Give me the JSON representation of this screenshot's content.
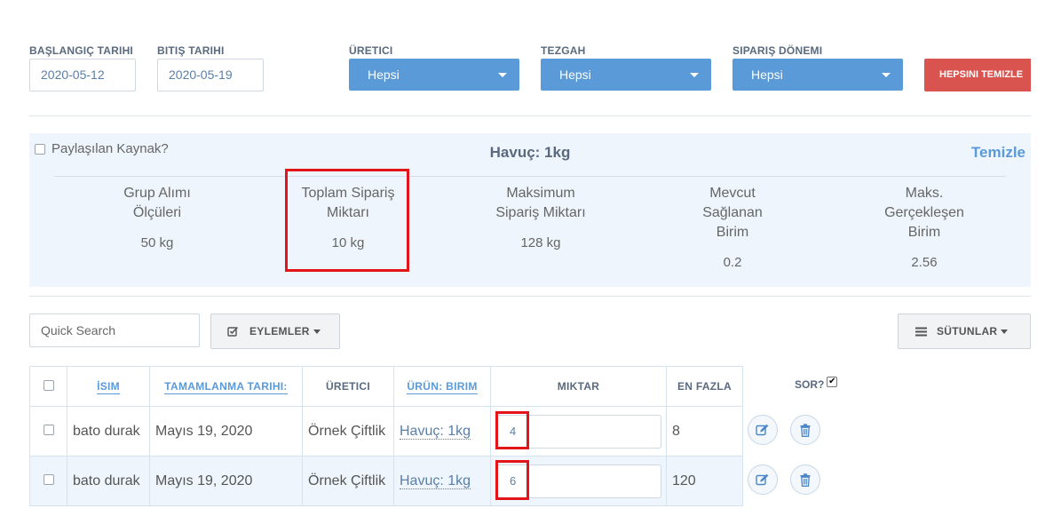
{
  "filters": {
    "start_date_label": "BAŞLANGIÇ TARIHI",
    "start_date_value": "2020-05-12",
    "end_date_label": "BITIŞ TARIHI",
    "end_date_value": "2020-05-19",
    "producer_label": "ÜRETICI",
    "producer_value": "Hepsi",
    "stall_label": "TEZGAH",
    "stall_value": "Hepsi",
    "period_label": "SIPARIŞ DÖNEMI",
    "period_value": "Hepsi",
    "clear_all_label": "HEPSINI TEMIZLE"
  },
  "summary": {
    "shared_resource_label": "Paylaşılan Kaynak?",
    "product_title": "Havuç: 1kg",
    "clear_link": "Temizle",
    "metrics": [
      {
        "label_line1": "Grup Alımı",
        "label_line2": "Ölçüleri",
        "label_line3": "",
        "value": "50 kg"
      },
      {
        "label_line1": "Toplam Sipariş",
        "label_line2": "Miktarı",
        "label_line3": "",
        "value": "10 kg"
      },
      {
        "label_line1": "Maksimum",
        "label_line2": "Sipariş Miktarı",
        "label_line3": "",
        "value": "128 kg"
      },
      {
        "label_line1": "Mevcut",
        "label_line2": "Sağlanan",
        "label_line3": "Birim",
        "value": "0.2"
      },
      {
        "label_line1": "Maks.",
        "label_line2": "Gerçekleşen",
        "label_line3": "Birim",
        "value": "2.56"
      }
    ]
  },
  "toolbar": {
    "search_placeholder": "Quick Search",
    "actions_label": "EYLEMLER",
    "columns_label": "SÜTUNLAR"
  },
  "table": {
    "headers": {
      "name": "İSIM",
      "completion_date": "TAMAMLANMA TARIHI:",
      "producer": "ÜRETICI",
      "product_unit": "ÜRÜN: BIRIM",
      "quantity": "MIKTAR",
      "max": "EN FAZLA",
      "ask": "SOR?"
    },
    "rows": [
      {
        "name": "bato durak",
        "date": "Mayıs 19, 2020",
        "producer": "Örnek Çiftlik",
        "product": "Havuç: 1kg",
        "quantity": "4",
        "max": "8"
      },
      {
        "name": "bato durak",
        "date": "Mayıs 19, 2020",
        "producer": "Örnek Çiftlik",
        "product": "Havuç: 1kg",
        "quantity": "6",
        "max": "120"
      }
    ]
  },
  "colors": {
    "accent": "#5a9ad9",
    "danger": "#d9534f",
    "panel": "#eef5fc",
    "highlight": "#e3151a"
  }
}
